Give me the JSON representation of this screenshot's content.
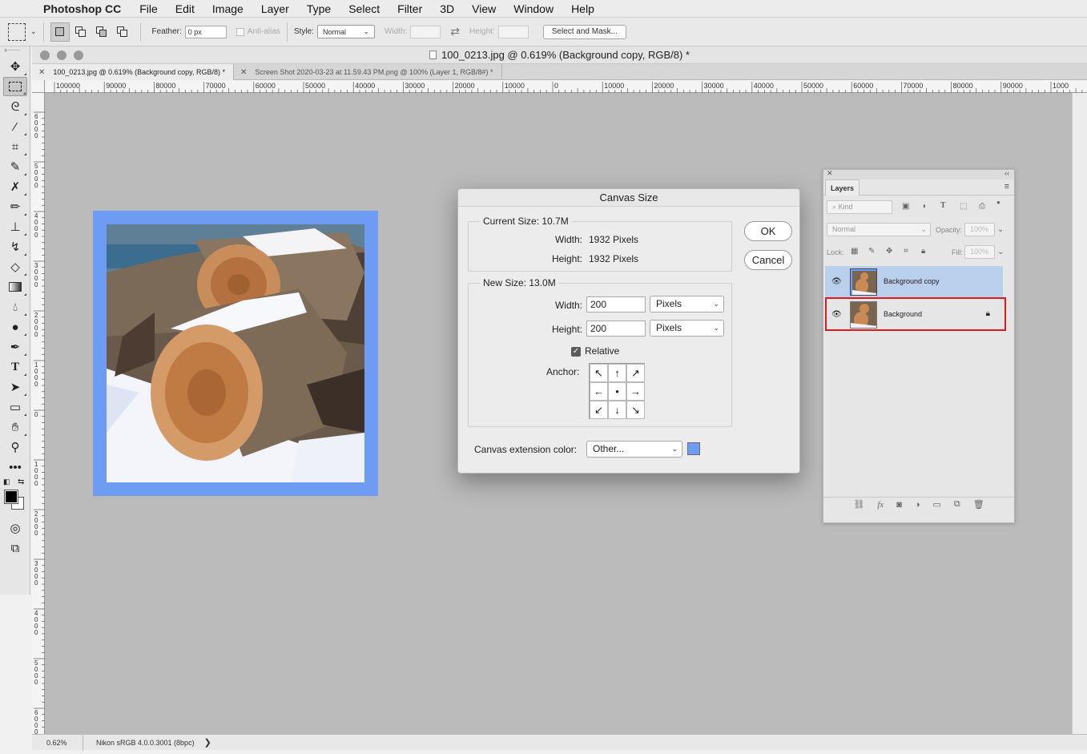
{
  "menubar": {
    "app_name": "Photoshop CC",
    "items": [
      "File",
      "Edit",
      "Image",
      "Layer",
      "Type",
      "Select",
      "Filter",
      "3D",
      "View",
      "Window",
      "Help"
    ]
  },
  "options_bar": {
    "feather_label": "Feather:",
    "feather_value": "0 px",
    "anti_alias_label": "Anti-alias",
    "style_label": "Style:",
    "style_value": "Normal",
    "width_label": "Width:",
    "height_label": "Height:",
    "select_mask_label": "Select and Mask..."
  },
  "document": {
    "window_title": "100_0213.jpg @ 0.619% (Background copy, RGB/8) *",
    "tabs": [
      {
        "label": "100_0213.jpg @ 0.619% (Background copy, RGB/8) *",
        "active": true
      },
      {
        "label": "Screen Shot 2020-03-23 at 11.59.43 PM.png @ 100% (Layer 1, RGB/8#) *",
        "active": false
      }
    ],
    "ruler_h_labels": [
      "100000",
      "90000",
      "80000",
      "70000",
      "60000",
      "50000",
      "40000",
      "30000",
      "20000",
      "10000",
      "0",
      "10000",
      "20000",
      "30000",
      "40000",
      "50000",
      "60000",
      "70000",
      "80000",
      "90000",
      "1000"
    ],
    "ruler_v_labels": [
      "6000",
      "5000",
      "4000",
      "3000",
      "2000",
      "1000",
      "0",
      "1000",
      "2000",
      "3000",
      "4000",
      "5000",
      "6000"
    ],
    "status_zoom": "0.62%",
    "status_profile": "Nikon sRGB 4.0.0.3001 (8bpc)",
    "status_arrow": "❯",
    "canvas_extension_color": "#6f9cf3"
  },
  "dialog": {
    "title": "Canvas Size",
    "current_size_label": "Current Size: 10.7M",
    "current_width_label": "Width:",
    "current_width_value": "1932 Pixels",
    "current_height_label": "Height:",
    "current_height_value": "1932 Pixels",
    "new_size_label": "New Size: 13.0M",
    "new_width_label": "Width:",
    "new_width_value": "200",
    "new_width_unit": "Pixels",
    "new_height_label": "Height:",
    "new_height_value": "200",
    "new_height_unit": "Pixels",
    "relative_label": "Relative",
    "relative_checked": true,
    "anchor_label": "Anchor:",
    "anchor_arrows": [
      "↖",
      "↑",
      "↗",
      "←",
      "●",
      "→",
      "↙",
      "↓",
      "↘"
    ],
    "extension_color_label": "Canvas extension color:",
    "extension_color_value": "Other...",
    "ok_label": "OK",
    "cancel_label": "Cancel"
  },
  "layers_panel": {
    "tab_label": "Layers",
    "kind_label": "Kind",
    "blend_mode": "Normal",
    "opacity_label": "Opacity:",
    "opacity_value": "100%",
    "lock_label": "Lock:",
    "fill_label": "Fill:",
    "fill_value": "100%",
    "layers": [
      {
        "name": "Background copy",
        "selected": true,
        "locked": false
      },
      {
        "name": "Background",
        "selected": false,
        "locked": true
      }
    ]
  }
}
